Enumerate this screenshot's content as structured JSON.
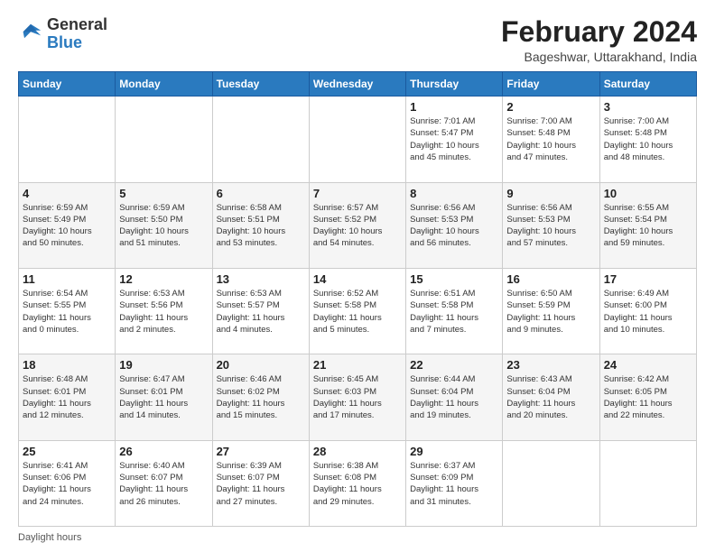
{
  "header": {
    "logo_general": "General",
    "logo_blue": "Blue",
    "month_title": "February 2024",
    "location": "Bageshwar, Uttarakhand, India"
  },
  "days_of_week": [
    "Sunday",
    "Monday",
    "Tuesday",
    "Wednesday",
    "Thursday",
    "Friday",
    "Saturday"
  ],
  "footer": {
    "daylight_label": "Daylight hours"
  },
  "weeks": [
    [
      {
        "day": "",
        "info": ""
      },
      {
        "day": "",
        "info": ""
      },
      {
        "day": "",
        "info": ""
      },
      {
        "day": "",
        "info": ""
      },
      {
        "day": "1",
        "info": "Sunrise: 7:01 AM\nSunset: 5:47 PM\nDaylight: 10 hours\nand 45 minutes."
      },
      {
        "day": "2",
        "info": "Sunrise: 7:00 AM\nSunset: 5:48 PM\nDaylight: 10 hours\nand 47 minutes."
      },
      {
        "day": "3",
        "info": "Sunrise: 7:00 AM\nSunset: 5:48 PM\nDaylight: 10 hours\nand 48 minutes."
      }
    ],
    [
      {
        "day": "4",
        "info": "Sunrise: 6:59 AM\nSunset: 5:49 PM\nDaylight: 10 hours\nand 50 minutes."
      },
      {
        "day": "5",
        "info": "Sunrise: 6:59 AM\nSunset: 5:50 PM\nDaylight: 10 hours\nand 51 minutes."
      },
      {
        "day": "6",
        "info": "Sunrise: 6:58 AM\nSunset: 5:51 PM\nDaylight: 10 hours\nand 53 minutes."
      },
      {
        "day": "7",
        "info": "Sunrise: 6:57 AM\nSunset: 5:52 PM\nDaylight: 10 hours\nand 54 minutes."
      },
      {
        "day": "8",
        "info": "Sunrise: 6:56 AM\nSunset: 5:53 PM\nDaylight: 10 hours\nand 56 minutes."
      },
      {
        "day": "9",
        "info": "Sunrise: 6:56 AM\nSunset: 5:53 PM\nDaylight: 10 hours\nand 57 minutes."
      },
      {
        "day": "10",
        "info": "Sunrise: 6:55 AM\nSunset: 5:54 PM\nDaylight: 10 hours\nand 59 minutes."
      }
    ],
    [
      {
        "day": "11",
        "info": "Sunrise: 6:54 AM\nSunset: 5:55 PM\nDaylight: 11 hours\nand 0 minutes."
      },
      {
        "day": "12",
        "info": "Sunrise: 6:53 AM\nSunset: 5:56 PM\nDaylight: 11 hours\nand 2 minutes."
      },
      {
        "day": "13",
        "info": "Sunrise: 6:53 AM\nSunset: 5:57 PM\nDaylight: 11 hours\nand 4 minutes."
      },
      {
        "day": "14",
        "info": "Sunrise: 6:52 AM\nSunset: 5:58 PM\nDaylight: 11 hours\nand 5 minutes."
      },
      {
        "day": "15",
        "info": "Sunrise: 6:51 AM\nSunset: 5:58 PM\nDaylight: 11 hours\nand 7 minutes."
      },
      {
        "day": "16",
        "info": "Sunrise: 6:50 AM\nSunset: 5:59 PM\nDaylight: 11 hours\nand 9 minutes."
      },
      {
        "day": "17",
        "info": "Sunrise: 6:49 AM\nSunset: 6:00 PM\nDaylight: 11 hours\nand 10 minutes."
      }
    ],
    [
      {
        "day": "18",
        "info": "Sunrise: 6:48 AM\nSunset: 6:01 PM\nDaylight: 11 hours\nand 12 minutes."
      },
      {
        "day": "19",
        "info": "Sunrise: 6:47 AM\nSunset: 6:01 PM\nDaylight: 11 hours\nand 14 minutes."
      },
      {
        "day": "20",
        "info": "Sunrise: 6:46 AM\nSunset: 6:02 PM\nDaylight: 11 hours\nand 15 minutes."
      },
      {
        "day": "21",
        "info": "Sunrise: 6:45 AM\nSunset: 6:03 PM\nDaylight: 11 hours\nand 17 minutes."
      },
      {
        "day": "22",
        "info": "Sunrise: 6:44 AM\nSunset: 6:04 PM\nDaylight: 11 hours\nand 19 minutes."
      },
      {
        "day": "23",
        "info": "Sunrise: 6:43 AM\nSunset: 6:04 PM\nDaylight: 11 hours\nand 20 minutes."
      },
      {
        "day": "24",
        "info": "Sunrise: 6:42 AM\nSunset: 6:05 PM\nDaylight: 11 hours\nand 22 minutes."
      }
    ],
    [
      {
        "day": "25",
        "info": "Sunrise: 6:41 AM\nSunset: 6:06 PM\nDaylight: 11 hours\nand 24 minutes."
      },
      {
        "day": "26",
        "info": "Sunrise: 6:40 AM\nSunset: 6:07 PM\nDaylight: 11 hours\nand 26 minutes."
      },
      {
        "day": "27",
        "info": "Sunrise: 6:39 AM\nSunset: 6:07 PM\nDaylight: 11 hours\nand 27 minutes."
      },
      {
        "day": "28",
        "info": "Sunrise: 6:38 AM\nSunset: 6:08 PM\nDaylight: 11 hours\nand 29 minutes."
      },
      {
        "day": "29",
        "info": "Sunrise: 6:37 AM\nSunset: 6:09 PM\nDaylight: 11 hours\nand 31 minutes."
      },
      {
        "day": "",
        "info": ""
      },
      {
        "day": "",
        "info": ""
      }
    ]
  ]
}
